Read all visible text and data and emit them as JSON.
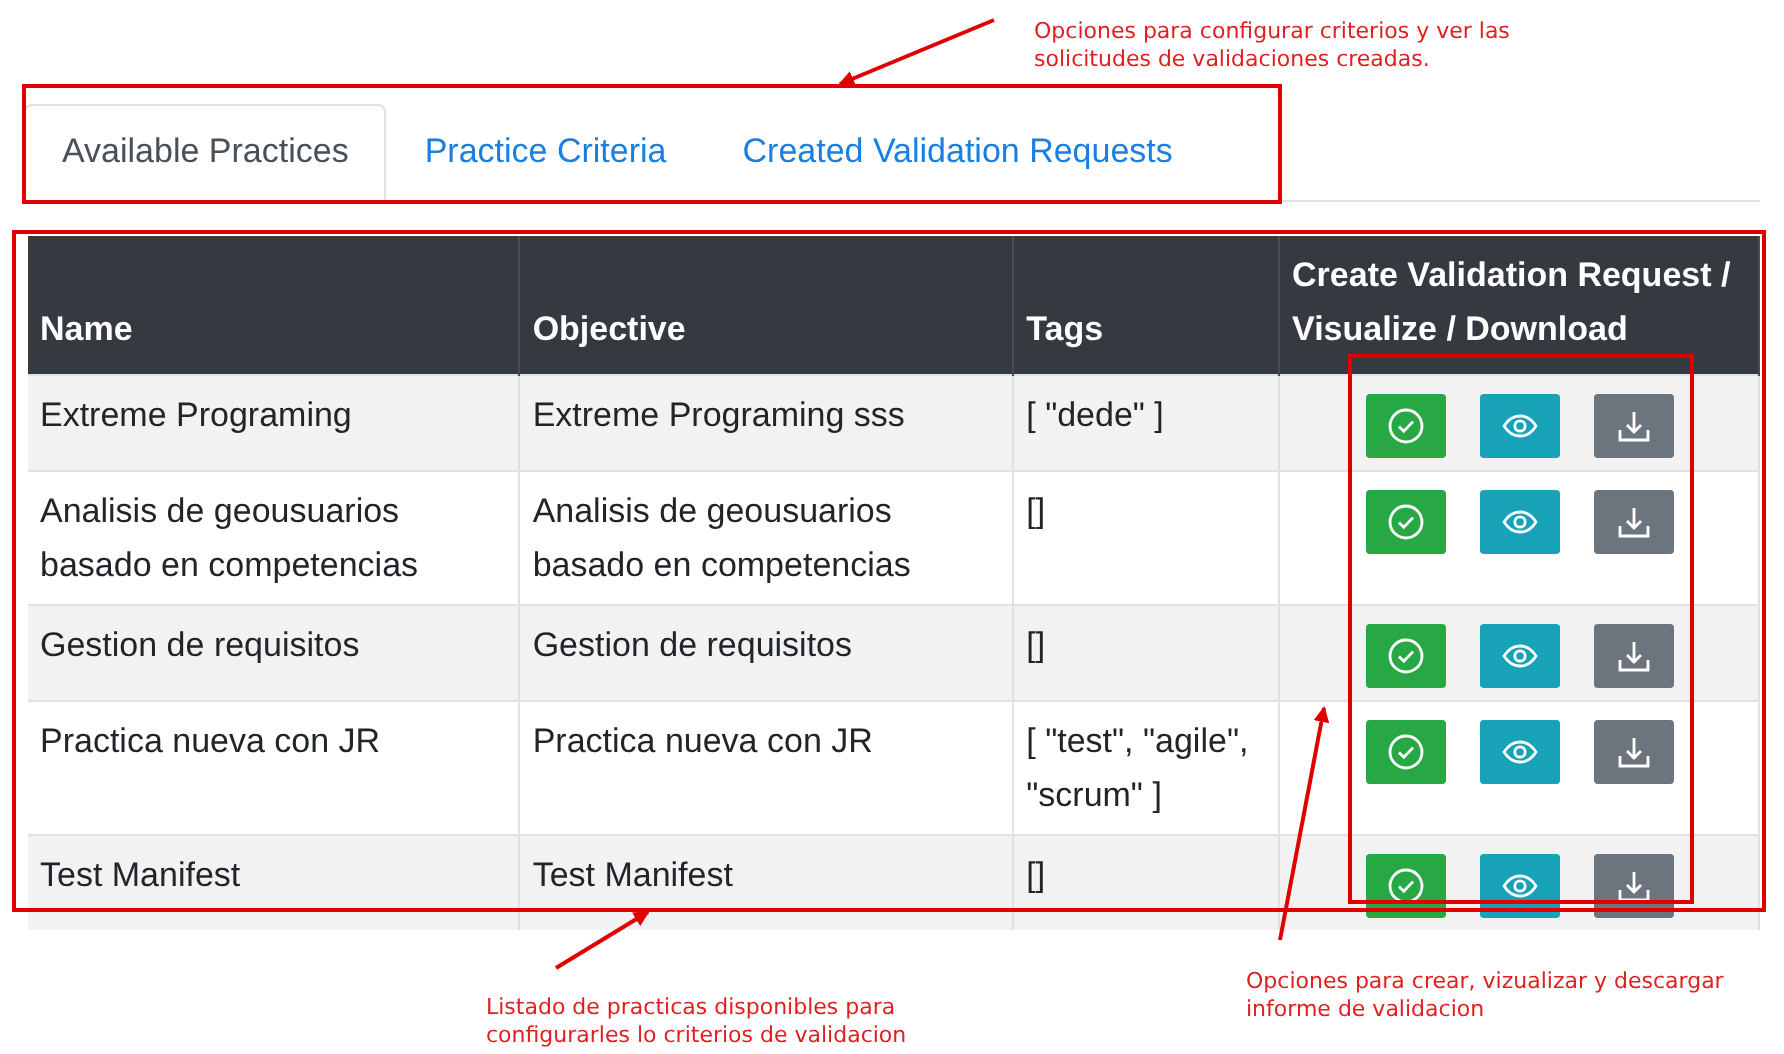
{
  "tabs": [
    {
      "label": "Available Practices",
      "selected": true
    },
    {
      "label": "Practice Criteria",
      "selected": false
    },
    {
      "label": "Created Validation Requests",
      "selected": false
    }
  ],
  "table": {
    "columns": [
      "Name",
      "Objective",
      "Tags",
      "Create Validation Request / Visualize / Download"
    ],
    "rows": [
      {
        "name": "Extreme Programing",
        "objective": "Extreme Programing sss",
        "tags": "[ \"dede\" ]"
      },
      {
        "name": "Analisis de geousuarios basado en competencias",
        "objective": "Analisis de geousuarios basado en competencias",
        "tags": "[]"
      },
      {
        "name": "Gestion de requisitos",
        "objective": "Gestion de requisitos",
        "tags": "[]"
      },
      {
        "name": "Practica nueva con JR",
        "objective": "Practica nueva con JR",
        "tags": "[ \"test\", \"agile\", \"scrum\" ]"
      },
      {
        "name": "Test Manifest",
        "objective": "Test Manifest",
        "tags": "[]"
      }
    ]
  },
  "annotations": [
    {
      "text": "Opciones para configurar criterios y ver las solicitudes de validaciones creadas."
    },
    {
      "text": "Listado de practicas disponibles para configurarles lo criterios de validacion"
    },
    {
      "text": "Opciones para crear, vizualizar y descargar informe de validacion"
    }
  ]
}
